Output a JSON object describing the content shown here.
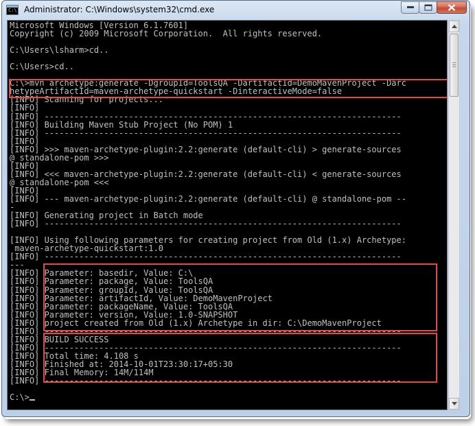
{
  "window": {
    "title": "Administrator: C:\\Windows\\system32\\cmd.exe",
    "icon_label": "C:\\",
    "buttons": [
      "minimize",
      "maximize",
      "close"
    ]
  },
  "console": {
    "lines": [
      "Microsoft Windows [Version 6.1.7601]",
      "Copyright (c) 2009 Microsoft Corporation.  All rights reserved.",
      "",
      "C:\\Users\\lsharm>cd..",
      "",
      "C:\\Users>cd..",
      "",
      "C:\\>mvn archetype:generate -DgroupId=ToolsQA -DartifactId=DemoMavenProject -Darc",
      "hetypeArtifactId=maven-archetype-quickstart -DinteractiveMode=false",
      "[INFO] Scanning for projects...",
      "[INFO]",
      "[INFO] ------------------------------------------------------------------------",
      "[INFO] Building Maven Stub Project (No POM) 1",
      "[INFO] ------------------------------------------------------------------------",
      "[INFO]",
      "[INFO] >>> maven-archetype-plugin:2.2:generate (default-cli) > generate-sources",
      "@ standalone-pom >>>",
      "[INFO]",
      "[INFO] <<< maven-archetype-plugin:2.2:generate (default-cli) < generate-sources",
      "@ standalone-pom <<<",
      "[INFO]",
      "[INFO] --- maven-archetype-plugin:2.2:generate (default-cli) @ standalone-pom --",
      "-",
      "[INFO] Generating project in Batch mode",
      "[INFO] ------------------------------------------------------------------------",
      "",
      "[INFO] Using following parameters for creating project from Old (1.x) Archetype:",
      " maven-archetype-quickstart:1.0",
      "[INFO] ------------------------------------------------------------------------",
      "---",
      "[INFO] Parameter: basedir, Value: C:\\",
      "[INFO] Parameter: package, Value: ToolsQA",
      "[INFO] Parameter: groupId, Value: ToolsQA",
      "[INFO] Parameter: artifactId, Value: DemoMavenProject",
      "[INFO] Parameter: packageName, Value: ToolsQA",
      "[INFO] Parameter: version, Value: 1.0-SNAPSHOT",
      "[INFO] project created from Old (1.x) Archetype in dir: C:\\DemoMavenProject",
      "[INFO] ------------------------------------------------------------------------",
      "[INFO] BUILD SUCCESS",
      "[INFO] ------------------------------------------------------------------------",
      "[INFO] Total time: 4.108 s",
      "[INFO] Finished at: 2014-10-01T23:30:17+05:30",
      "[INFO] Final Memory: 14M/114M",
      "[INFO] ------------------------------------------------------------------------",
      "",
      "C:\\>"
    ]
  },
  "colors": {
    "console_bg": "#000000",
    "console_text": "#c0c0c0",
    "highlight": "#e04a4a"
  }
}
